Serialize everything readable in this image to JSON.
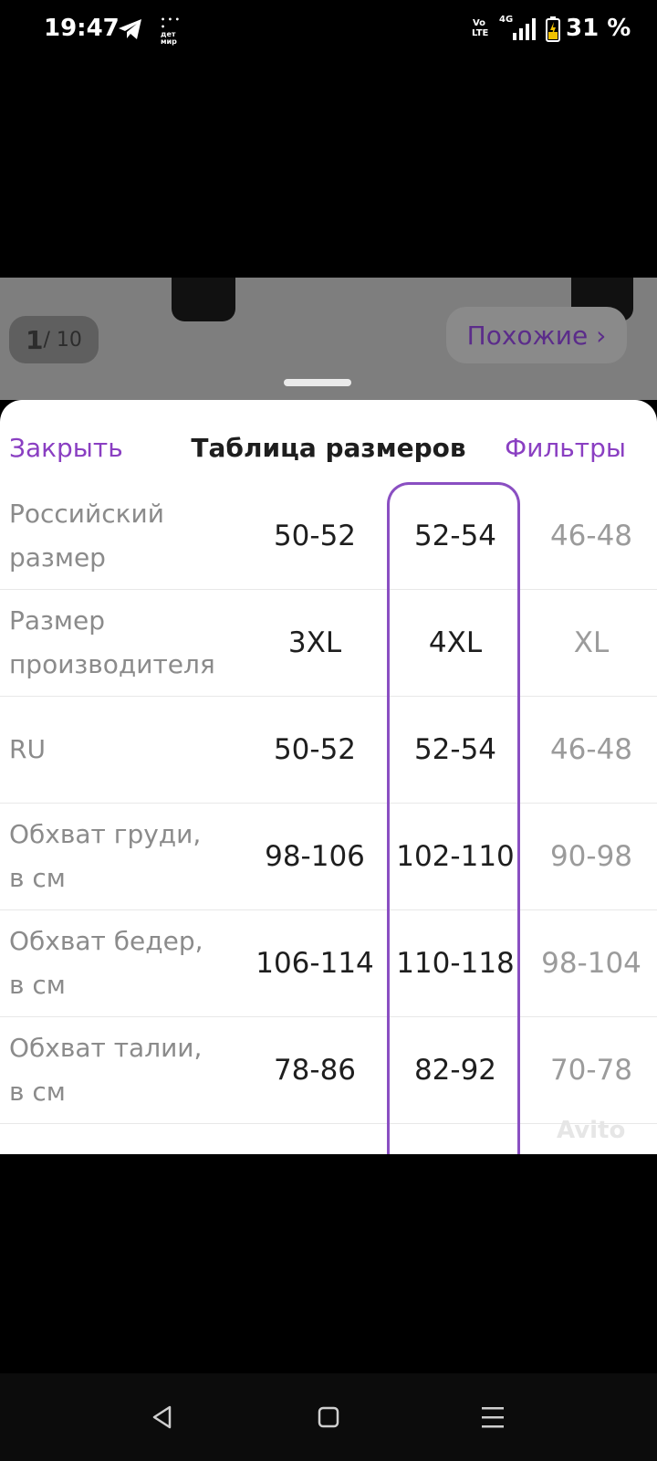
{
  "status_bar": {
    "time": "19:47",
    "telegram_icon": "telegram-icon",
    "app_icon_text": "дет мир",
    "volte_label": "Vo LTE",
    "network": "4G",
    "battery": "31 %"
  },
  "gallery": {
    "counter_current": "1",
    "counter_total": "/ 10",
    "similar_button": "Похожие ›"
  },
  "sheet": {
    "close_label": "Закрыть",
    "title": "Таблица размеров",
    "filters_label": "Фильтры",
    "selected_column": 2,
    "highlight_color": "#8a4fc2",
    "rows": [
      {
        "label": "Российский размер",
        "values": [
          "50-52",
          "52-54",
          "46-48"
        ]
      },
      {
        "label": "Размер производителя",
        "values": [
          "3XL",
          "4XL",
          "XL"
        ]
      },
      {
        "label": "RU",
        "values": [
          "50-52",
          "52-54",
          "46-48"
        ]
      },
      {
        "label": "Обхват груди, в см",
        "values": [
          "98-106",
          "102-110",
          "90-98"
        ]
      },
      {
        "label": "Обхват бедер, в см",
        "values": [
          "106-114",
          "110-118",
          "98-104"
        ]
      },
      {
        "label": "Обхват талии, в см",
        "values": [
          "78-86",
          "82-92",
          "70-78"
        ]
      }
    ],
    "watermark": "Avito"
  },
  "nav": {
    "back_icon": "back-triangle-icon",
    "home_icon": "home-square-icon",
    "menu_icon": "menu-icon"
  }
}
